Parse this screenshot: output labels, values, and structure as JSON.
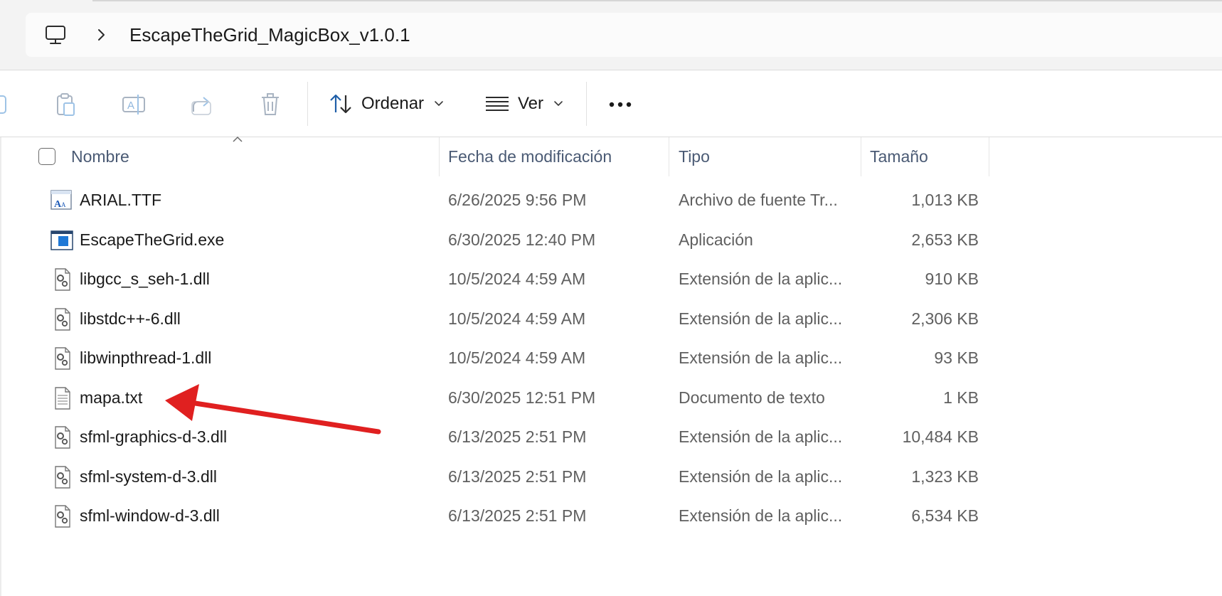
{
  "address_bar": {
    "path_label": "EscapeTheGrid_MagicBox_v1.0.1",
    "root_icon": "this-pc-monitor-icon",
    "separator_icon": "chevron-right-icon"
  },
  "command_bar": {
    "icons": [
      "new-item-icon",
      "paste-icon",
      "rename-icon",
      "share-icon",
      "delete-icon"
    ],
    "sort_label": "Ordenar",
    "sort_icon": "sort-arrows-icon",
    "view_label": "Ver",
    "view_icon": "list-view-icon",
    "more_icon": "more-ellipsis-icon"
  },
  "columns": {
    "name": "Nombre",
    "date": "Fecha de modificación",
    "type": "Tipo",
    "size": "Tamaño"
  },
  "files": [
    {
      "name": "ARIAL.TTF",
      "date": "6/26/2025 9:56 PM",
      "type": "Archivo de fuente Tr...",
      "size": "1,013 KB",
      "icon": "font-file-icon"
    },
    {
      "name": "EscapeTheGrid.exe",
      "date": "6/30/2025 12:40 PM",
      "type": "Aplicación",
      "size": "2,653 KB",
      "icon": "application-icon"
    },
    {
      "name": "libgcc_s_seh-1.dll",
      "date": "10/5/2024 4:59 AM",
      "type": "Extensión de la aplic...",
      "size": "910 KB",
      "icon": "dll-file-icon"
    },
    {
      "name": "libstdc++-6.dll",
      "date": "10/5/2024 4:59 AM",
      "type": "Extensión de la aplic...",
      "size": "2,306 KB",
      "icon": "dll-file-icon"
    },
    {
      "name": "libwinpthread-1.dll",
      "date": "10/5/2024 4:59 AM",
      "type": "Extensión de la aplic...",
      "size": "93 KB",
      "icon": "dll-file-icon"
    },
    {
      "name": "mapa.txt",
      "date": "6/30/2025 12:51 PM",
      "type": "Documento de texto",
      "size": "1 KB",
      "icon": "text-file-icon"
    },
    {
      "name": "sfml-graphics-d-3.dll",
      "date": "6/13/2025 2:51 PM",
      "type": "Extensión de la aplic...",
      "size": "10,484 KB",
      "icon": "dll-file-icon"
    },
    {
      "name": "sfml-system-d-3.dll",
      "date": "6/13/2025 2:51 PM",
      "type": "Extensión de la aplic...",
      "size": "1,323 KB",
      "icon": "dll-file-icon"
    },
    {
      "name": "sfml-window-d-3.dll",
      "date": "6/13/2025 2:51 PM",
      "type": "Extensión de la aplic...",
      "size": "6,534 KB",
      "icon": "dll-file-icon"
    }
  ],
  "annotation": {
    "color": "#e02020",
    "icon": "red-arrow-annotation",
    "points_to": "mapa.txt"
  }
}
